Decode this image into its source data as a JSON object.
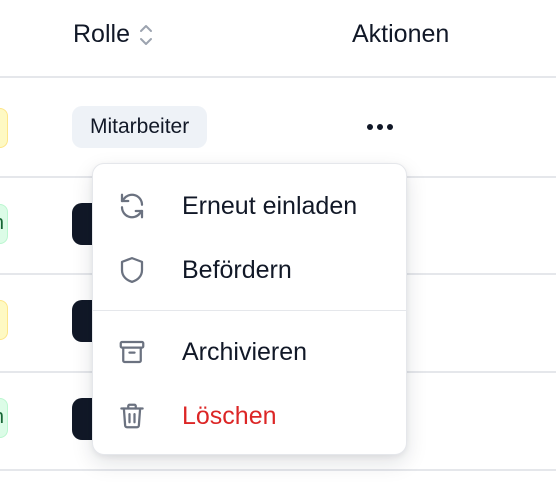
{
  "table": {
    "headers": {
      "role": "Rolle",
      "actions": "Aktionen"
    },
    "first_row_role": "Mitarbeiter",
    "edge_badge_text": "n"
  },
  "menu": {
    "items": [
      {
        "label": "Erneut einladen",
        "icon": "refresh-icon"
      },
      {
        "label": "Befördern",
        "icon": "shield-icon"
      },
      {
        "label": "Archivieren",
        "icon": "archive-icon"
      },
      {
        "label": "Löschen",
        "icon": "trash-icon",
        "color": "#dc2626"
      }
    ]
  },
  "colors": {
    "danger": "#dc2626",
    "icon_gray": "#6b7280",
    "border": "#e5e7eb"
  }
}
